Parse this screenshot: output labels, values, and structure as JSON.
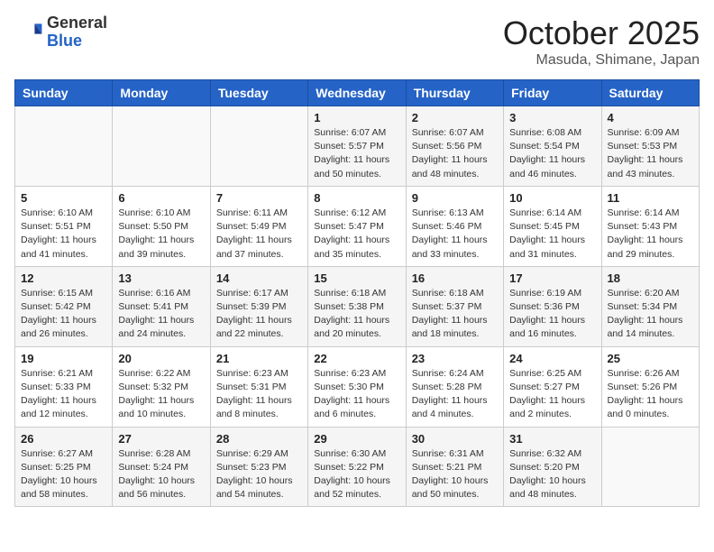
{
  "header": {
    "logo_general": "General",
    "logo_blue": "Blue",
    "month_title": "October 2025",
    "location": "Masuda, Shimane, Japan"
  },
  "weekdays": [
    "Sunday",
    "Monday",
    "Tuesday",
    "Wednesday",
    "Thursday",
    "Friday",
    "Saturday"
  ],
  "weeks": [
    [
      {
        "day": "",
        "info": ""
      },
      {
        "day": "",
        "info": ""
      },
      {
        "day": "",
        "info": ""
      },
      {
        "day": "1",
        "info": "Sunrise: 6:07 AM\nSunset: 5:57 PM\nDaylight: 11 hours\nand 50 minutes."
      },
      {
        "day": "2",
        "info": "Sunrise: 6:07 AM\nSunset: 5:56 PM\nDaylight: 11 hours\nand 48 minutes."
      },
      {
        "day": "3",
        "info": "Sunrise: 6:08 AM\nSunset: 5:54 PM\nDaylight: 11 hours\nand 46 minutes."
      },
      {
        "day": "4",
        "info": "Sunrise: 6:09 AM\nSunset: 5:53 PM\nDaylight: 11 hours\nand 43 minutes."
      }
    ],
    [
      {
        "day": "5",
        "info": "Sunrise: 6:10 AM\nSunset: 5:51 PM\nDaylight: 11 hours\nand 41 minutes."
      },
      {
        "day": "6",
        "info": "Sunrise: 6:10 AM\nSunset: 5:50 PM\nDaylight: 11 hours\nand 39 minutes."
      },
      {
        "day": "7",
        "info": "Sunrise: 6:11 AM\nSunset: 5:49 PM\nDaylight: 11 hours\nand 37 minutes."
      },
      {
        "day": "8",
        "info": "Sunrise: 6:12 AM\nSunset: 5:47 PM\nDaylight: 11 hours\nand 35 minutes."
      },
      {
        "day": "9",
        "info": "Sunrise: 6:13 AM\nSunset: 5:46 PM\nDaylight: 11 hours\nand 33 minutes."
      },
      {
        "day": "10",
        "info": "Sunrise: 6:14 AM\nSunset: 5:45 PM\nDaylight: 11 hours\nand 31 minutes."
      },
      {
        "day": "11",
        "info": "Sunrise: 6:14 AM\nSunset: 5:43 PM\nDaylight: 11 hours\nand 29 minutes."
      }
    ],
    [
      {
        "day": "12",
        "info": "Sunrise: 6:15 AM\nSunset: 5:42 PM\nDaylight: 11 hours\nand 26 minutes."
      },
      {
        "day": "13",
        "info": "Sunrise: 6:16 AM\nSunset: 5:41 PM\nDaylight: 11 hours\nand 24 minutes."
      },
      {
        "day": "14",
        "info": "Sunrise: 6:17 AM\nSunset: 5:39 PM\nDaylight: 11 hours\nand 22 minutes."
      },
      {
        "day": "15",
        "info": "Sunrise: 6:18 AM\nSunset: 5:38 PM\nDaylight: 11 hours\nand 20 minutes."
      },
      {
        "day": "16",
        "info": "Sunrise: 6:18 AM\nSunset: 5:37 PM\nDaylight: 11 hours\nand 18 minutes."
      },
      {
        "day": "17",
        "info": "Sunrise: 6:19 AM\nSunset: 5:36 PM\nDaylight: 11 hours\nand 16 minutes."
      },
      {
        "day": "18",
        "info": "Sunrise: 6:20 AM\nSunset: 5:34 PM\nDaylight: 11 hours\nand 14 minutes."
      }
    ],
    [
      {
        "day": "19",
        "info": "Sunrise: 6:21 AM\nSunset: 5:33 PM\nDaylight: 11 hours\nand 12 minutes."
      },
      {
        "day": "20",
        "info": "Sunrise: 6:22 AM\nSunset: 5:32 PM\nDaylight: 11 hours\nand 10 minutes."
      },
      {
        "day": "21",
        "info": "Sunrise: 6:23 AM\nSunset: 5:31 PM\nDaylight: 11 hours\nand 8 minutes."
      },
      {
        "day": "22",
        "info": "Sunrise: 6:23 AM\nSunset: 5:30 PM\nDaylight: 11 hours\nand 6 minutes."
      },
      {
        "day": "23",
        "info": "Sunrise: 6:24 AM\nSunset: 5:28 PM\nDaylight: 11 hours\nand 4 minutes."
      },
      {
        "day": "24",
        "info": "Sunrise: 6:25 AM\nSunset: 5:27 PM\nDaylight: 11 hours\nand 2 minutes."
      },
      {
        "day": "25",
        "info": "Sunrise: 6:26 AM\nSunset: 5:26 PM\nDaylight: 11 hours\nand 0 minutes."
      }
    ],
    [
      {
        "day": "26",
        "info": "Sunrise: 6:27 AM\nSunset: 5:25 PM\nDaylight: 10 hours\nand 58 minutes."
      },
      {
        "day": "27",
        "info": "Sunrise: 6:28 AM\nSunset: 5:24 PM\nDaylight: 10 hours\nand 56 minutes."
      },
      {
        "day": "28",
        "info": "Sunrise: 6:29 AM\nSunset: 5:23 PM\nDaylight: 10 hours\nand 54 minutes."
      },
      {
        "day": "29",
        "info": "Sunrise: 6:30 AM\nSunset: 5:22 PM\nDaylight: 10 hours\nand 52 minutes."
      },
      {
        "day": "30",
        "info": "Sunrise: 6:31 AM\nSunset: 5:21 PM\nDaylight: 10 hours\nand 50 minutes."
      },
      {
        "day": "31",
        "info": "Sunrise: 6:32 AM\nSunset: 5:20 PM\nDaylight: 10 hours\nand 48 minutes."
      },
      {
        "day": "",
        "info": ""
      }
    ]
  ]
}
